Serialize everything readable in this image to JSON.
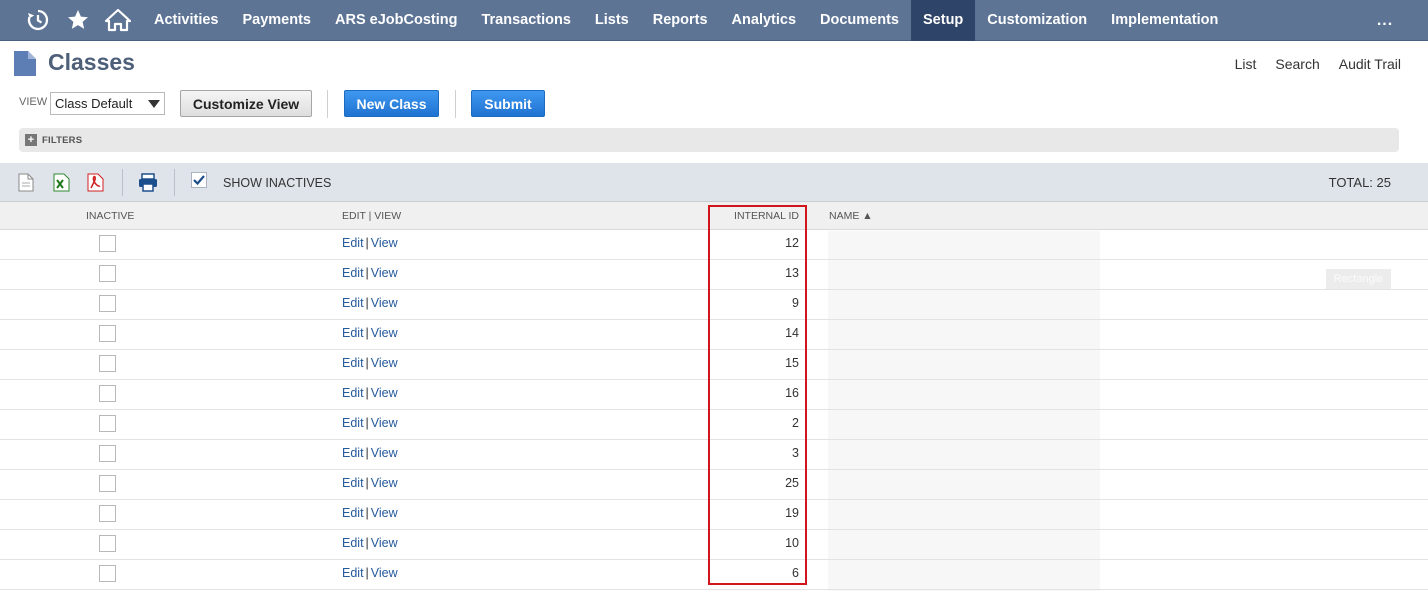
{
  "nav": {
    "icons": [
      "recent-icon",
      "star-icon",
      "home-icon"
    ],
    "items": [
      {
        "label": "Activities",
        "active": false
      },
      {
        "label": "Payments",
        "active": false
      },
      {
        "label": "ARS eJobCosting",
        "active": false
      },
      {
        "label": "Transactions",
        "active": false
      },
      {
        "label": "Lists",
        "active": false
      },
      {
        "label": "Reports",
        "active": false
      },
      {
        "label": "Analytics",
        "active": false
      },
      {
        "label": "Documents",
        "active": false
      },
      {
        "label": "Setup",
        "active": true
      },
      {
        "label": "Customization",
        "active": false
      },
      {
        "label": "Implementation",
        "active": false
      }
    ],
    "more": "..."
  },
  "header": {
    "title": "Classes",
    "links": [
      "List",
      "Search",
      "Audit Trail"
    ]
  },
  "view": {
    "label": "VIEW",
    "selected": "Class Default",
    "customize_label": "Customize View",
    "new_label": "New Class",
    "submit_label": "Submit"
  },
  "filters": {
    "label": "FILTERS"
  },
  "toolbar": {
    "show_inactives_label": "SHOW INACTIVES",
    "show_inactives_checked": true,
    "total": "TOTAL: 25"
  },
  "table": {
    "columns": {
      "inactive": "INACTIVE",
      "edit_view": "EDIT | VIEW",
      "internal_id": "INTERNAL ID",
      "name": "NAME ▲"
    },
    "edit_label": "Edit",
    "separator": "|",
    "view_label": "View",
    "rows": [
      {
        "internal_id": "12"
      },
      {
        "internal_id": "13"
      },
      {
        "internal_id": "9"
      },
      {
        "internal_id": "14"
      },
      {
        "internal_id": "15"
      },
      {
        "internal_id": "16"
      },
      {
        "internal_id": "2"
      },
      {
        "internal_id": "3"
      },
      {
        "internal_id": "25"
      },
      {
        "internal_id": "19"
      },
      {
        "internal_id": "10"
      },
      {
        "internal_id": "6"
      }
    ]
  },
  "annotation": {
    "label": "Rectangle",
    "color": "#d0161c"
  },
  "colors": {
    "nav_bg": "#5d7495",
    "nav_active": "#2e4468",
    "button_blue": "#1f73d1",
    "link": "#255a9c"
  }
}
